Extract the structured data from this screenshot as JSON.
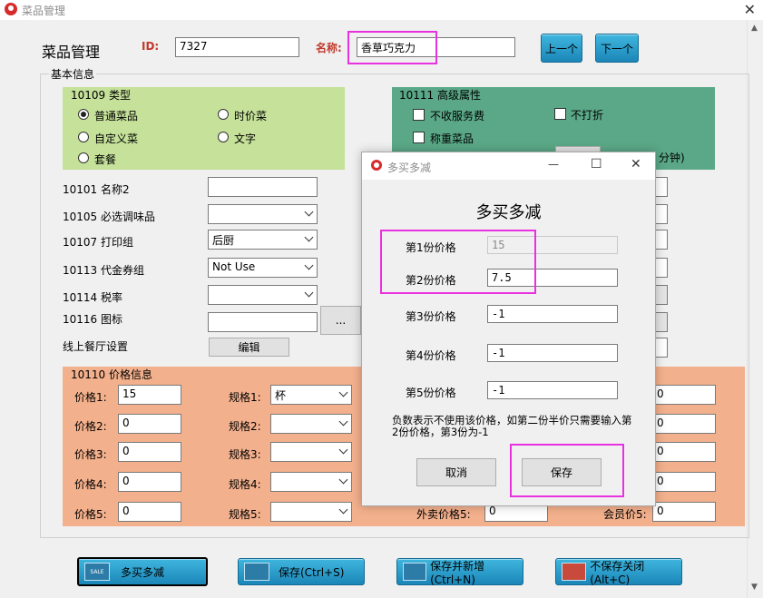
{
  "window": {
    "title": "菜品管理",
    "close": "✕"
  },
  "header": {
    "title": "菜品管理",
    "id_label": "ID:",
    "id_value": "7327",
    "name_label": "名称:",
    "name_value": "香草巧克力",
    "prev_button": "上一个",
    "next_button": "下一个"
  },
  "basic_info": {
    "title": "基本信息",
    "type_group": {
      "title": "10109 类型",
      "options": [
        "普通菜品",
        "时价菜",
        "自定义菜",
        "文字",
        "套餐"
      ],
      "selected": "普通菜品"
    },
    "advanced_group": {
      "title": "10111 高级属性",
      "checkbox_no_service": "不收服务费",
      "checkbox_no_discount": "不打折",
      "checkbox_weighed": "称重菜品",
      "partial_text": "分钟)"
    },
    "fields": {
      "name2_label": "10101 名称2",
      "name2_value": "",
      "seasoning_label": "10105 必选调味品",
      "seasoning_value": "",
      "print_group_label": "10107 打印组",
      "print_group_value": "后厨",
      "coupon_group_label": "10113 代金券组",
      "coupon_group_value": "Not Use",
      "tax_label": "10114 税率",
      "tax_value": "",
      "icon_label": "10116 图标",
      "icon_value": "",
      "browse_button": "...",
      "online_label": "线上餐厅设置",
      "edit_button": "编辑"
    }
  },
  "price_info": {
    "title": "10110 价格信息",
    "price_labels": [
      "价格1:",
      "价格2:",
      "价格3:",
      "价格4:",
      "价格5:"
    ],
    "price_values": [
      "15",
      "0",
      "0",
      "0",
      "0"
    ],
    "spec_labels": [
      "规格1:",
      "规格2:",
      "规格3:",
      "规格4:",
      "规格5:"
    ],
    "spec_values": [
      "杯",
      "",
      "",
      "",
      ""
    ],
    "right_values": [
      "0",
      "0",
      "0",
      "0"
    ],
    "takeout_label": "外卖价格5:",
    "takeout_value": "0",
    "member_label": "会员价5:",
    "member_value": "0"
  },
  "bottom_buttons": {
    "multi_buy": "多买多减",
    "multi_buy_badge": "SALE",
    "save": "保存(Ctrl+S)",
    "save_new": "保存并新增(Ctrl+N)",
    "close_nosave": "不保存关闭(Alt+C)"
  },
  "dialog": {
    "title": "多买多减",
    "heading": "多买多减",
    "rows": [
      {
        "label": "第1份价格",
        "value": "15"
      },
      {
        "label": "第2份价格",
        "value": "7.5"
      },
      {
        "label": "第3份价格",
        "value": "-1"
      },
      {
        "label": "第4份价格",
        "value": "-1"
      },
      {
        "label": "第5份价格",
        "value": "-1"
      }
    ],
    "hint": "负数表示不使用该价格，如第二份半价只需要输入第2份价格，第3份为-1",
    "cancel_button": "取消",
    "save_button": "保存",
    "minimize": "—",
    "maximize": "☐",
    "close": "✕"
  },
  "colors": {
    "type_group_bg": "#c5e19a",
    "advanced_group_bg": "#5aa887",
    "price_group_bg": "#f3b08c",
    "blue_button": "#1b86b8",
    "highlight": "#e832e0"
  }
}
